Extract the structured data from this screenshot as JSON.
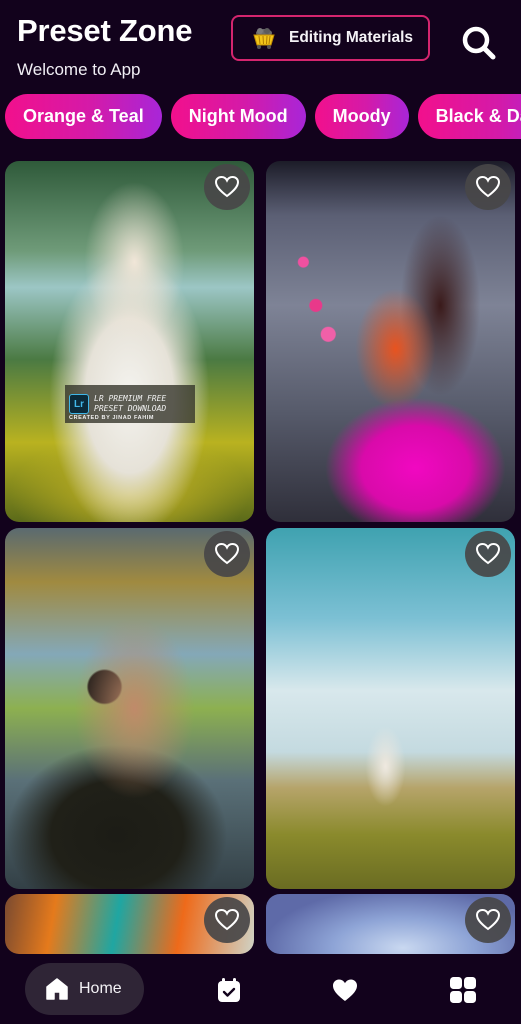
{
  "header": {
    "title": "Preset Zone",
    "subtitle": "Welcome to App",
    "editing_button_label": "Editing Materials",
    "editing_button_icon": "mining-cart-icon",
    "search_icon": "search-icon",
    "accent_border_color": "#d4256e"
  },
  "categories": [
    {
      "label": "Orange & Teal"
    },
    {
      "label": "Night Mood"
    },
    {
      "label": "Moody"
    },
    {
      "label": "Black & Dark"
    }
  ],
  "chip_gradient": [
    "#f2108c",
    "#a826d8"
  ],
  "presets": [
    {
      "image": "woman in white ao dai with flowers",
      "favorite": false,
      "watermark": {
        "badge": "Lr",
        "line1": "LR PREMIUM FREE",
        "line2": "PRESET DOWNLOAD",
        "line3": "CREATED BY JINAD FAHIM"
      }
    },
    {
      "image": "woman in orange dress with pink lotus",
      "favorite": false
    },
    {
      "image": "woman holding camera",
      "favorite": false
    },
    {
      "image": "woman in white dress in field with bicycle",
      "favorite": false
    },
    {
      "image": "colorful graffiti wall",
      "favorite": false
    },
    {
      "image": "blue gradient sky",
      "favorite": false
    }
  ],
  "bottom_nav": {
    "items": [
      {
        "label": "Home",
        "icon": "home-icon",
        "active": true
      },
      {
        "label": "",
        "icon": "calendar-check-icon",
        "active": false
      },
      {
        "label": "",
        "icon": "heart-icon",
        "active": false
      },
      {
        "label": "",
        "icon": "grid-icon",
        "active": false
      }
    ]
  },
  "colors": {
    "background": "#12021c",
    "nav_active_bg": "#2f2536",
    "fav_button_bg": "#484648"
  }
}
